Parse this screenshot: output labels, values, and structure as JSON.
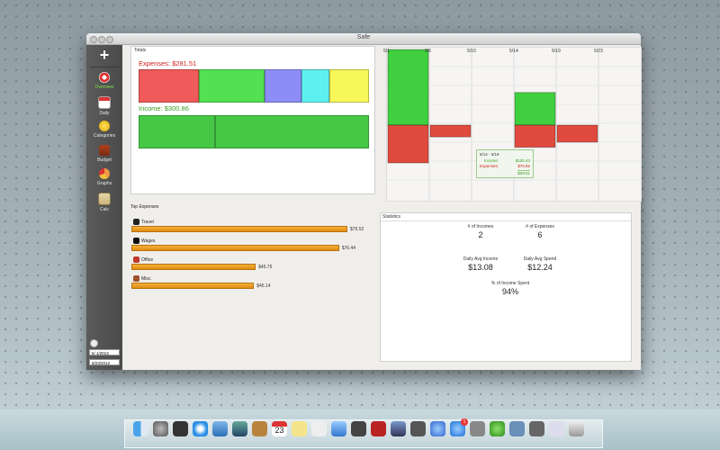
{
  "app": {
    "title": "Safe"
  },
  "sidebar": {
    "add_label": "+",
    "items": [
      {
        "label": "Overview",
        "icon": "lifebuoy-icon",
        "active": true
      },
      {
        "label": "Daily",
        "icon": "calendar-icon"
      },
      {
        "label": "Categories",
        "icon": "lightbulb-icon"
      },
      {
        "label": "Budget",
        "icon": "briefcase-icon"
      },
      {
        "label": "Graphs",
        "icon": "pie-chart-icon"
      },
      {
        "label": "Calc",
        "icon": "calculator-icon"
      }
    ],
    "date_start": "5/ 1/2013",
    "date_end": "5/23/2013"
  },
  "totals": {
    "title": "Totals",
    "expenses_label": "Expenses: $281.51",
    "income_label": "Income: $300.86",
    "expense_segments": [
      {
        "color": "#f05a5a",
        "share": 0.262
      },
      {
        "color": "#53e053",
        "share": 0.285
      },
      {
        "color": "#8d8df7",
        "share": 0.159
      },
      {
        "color": "#5ef0f0",
        "share": 0.122
      },
      {
        "color": "#f7f75a",
        "share": 0.172
      }
    ],
    "income_segments": [
      {
        "color": "#46c846",
        "share": 0.333
      },
      {
        "color": "#46c846",
        "share": 0.667
      }
    ]
  },
  "top_expenses": {
    "title": "Top Expenses",
    "items": [
      {
        "name": "Travel",
        "value": 79.52,
        "label": "$79.52",
        "icon": "travel-icon"
      },
      {
        "name": "Wages",
        "value": 76.44,
        "label": "$76.44",
        "icon": "wages-icon"
      },
      {
        "name": "Office",
        "value": 45.75,
        "label": "$45.75",
        "icon": "office-icon"
      },
      {
        "name": "Misc.",
        "value": 45.14,
        "label": "$45.14",
        "icon": "misc-icon"
      }
    ]
  },
  "chart_data": {
    "type": "bar",
    "categories": [
      "5/1",
      "5/6",
      "5/10",
      "5/14",
      "5/19",
      "5/23"
    ],
    "series": [
      {
        "name": "Income",
        "values": [
          160,
          0,
          0,
          69,
          0,
          0
        ]
      },
      {
        "name": "Expenses",
        "values": [
          -80,
          -25,
          0,
          -47,
          -36,
          0
        ]
      }
    ],
    "colors": {
      "income": "#3fcf3f",
      "expenses": "#e04a3e"
    },
    "tick_labels": [
      "5/1",
      "5/6",
      "5/10",
      "5/14",
      "5/19",
      "5/23"
    ],
    "tooltip": {
      "range": "5/14 - 5/19",
      "income_label": "Income:",
      "income_value": "$100.43",
      "expenses_label": "Expenses:",
      "expenses_value": "$70.82",
      "net_value": "$29.61"
    }
  },
  "statistics": {
    "title": "Statistics",
    "num_incomes_label": "# of Incomes",
    "num_incomes": "2",
    "num_expenses_label": "# of Expenses",
    "num_expenses": "6",
    "daily_avg_income_label": "Daily Avg Income",
    "daily_avg_income": "$13.08",
    "daily_avg_spend_label": "Daily Avg Spend",
    "daily_avg_spend": "$12.24",
    "pct_spent_label": "% of Income Spent",
    "pct_spent": "94%"
  },
  "dock": {
    "calendar_day": "23",
    "badge": "1"
  }
}
